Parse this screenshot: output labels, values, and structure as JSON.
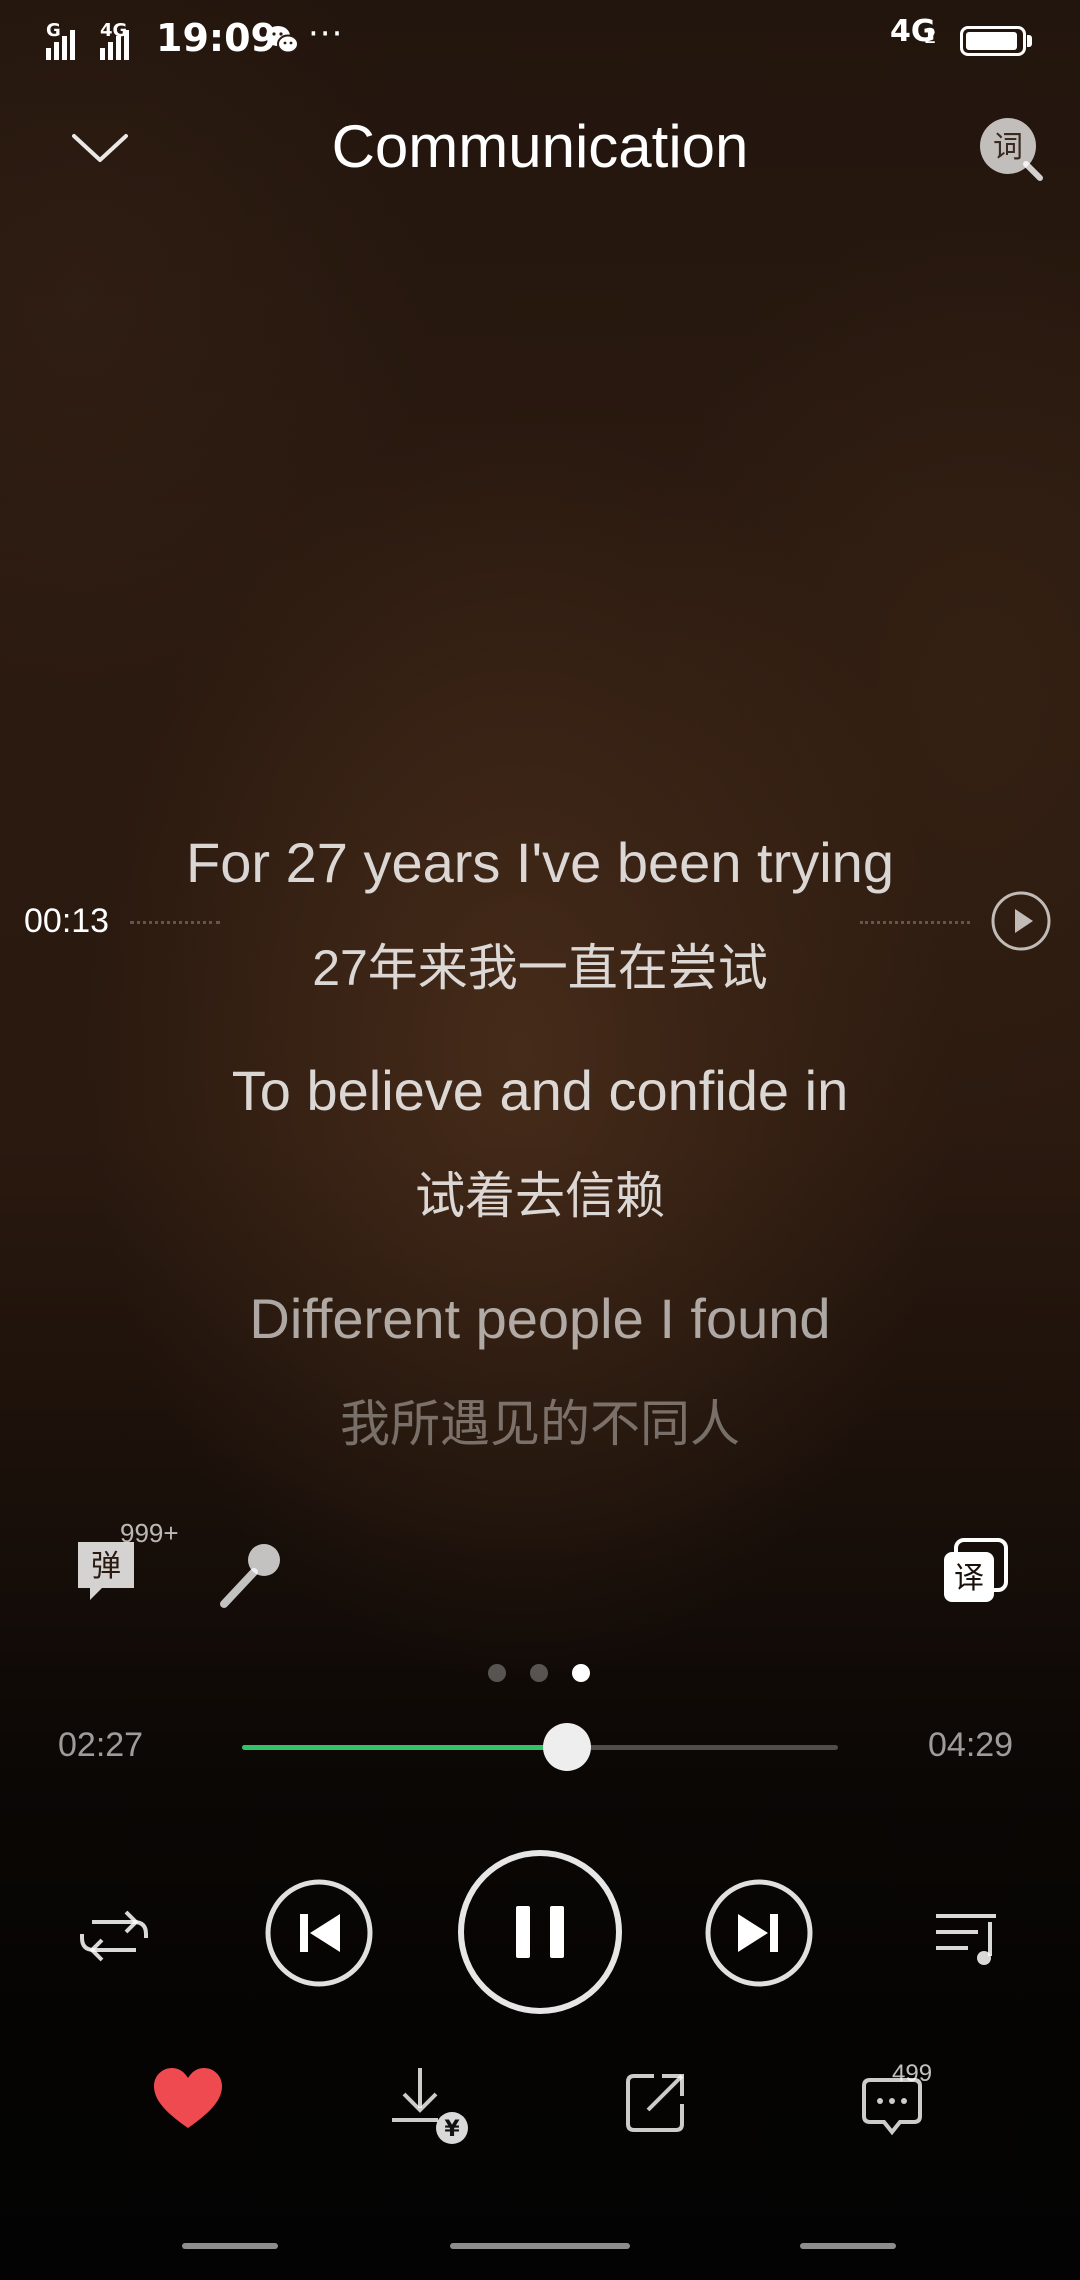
{
  "status_bar": {
    "sim1_label": "G",
    "sim2_label": "4G",
    "time": "19:09",
    "more": "···",
    "network": "4G",
    "network_sub": "2",
    "battery_level": 0.95
  },
  "header": {
    "title": "Communication",
    "lyrics_button_label": "词"
  },
  "lyrics": {
    "current_time": "00:13",
    "lines": [
      {
        "en": "For 27 years I've been trying",
        "zh": "27年来我一直在尝试",
        "state": "active"
      },
      {
        "en": "To believe and confide in",
        "zh": "试着去信赖",
        "state": "active"
      },
      {
        "en": "Different people I found",
        "zh": "我所遇见的不同人",
        "state": "dim"
      }
    ]
  },
  "tools": {
    "danmu_label": "弹",
    "danmu_count": "999+",
    "translate_label": "译"
  },
  "pager": {
    "count": 3,
    "active_index": 2
  },
  "progress": {
    "elapsed": "02:27",
    "total": "04:29",
    "fraction": 0.546,
    "color": "#33c26a"
  },
  "actions": {
    "liked": true,
    "like_color": "#ef4a4f",
    "download_badge": "¥",
    "comment_count": "499"
  }
}
